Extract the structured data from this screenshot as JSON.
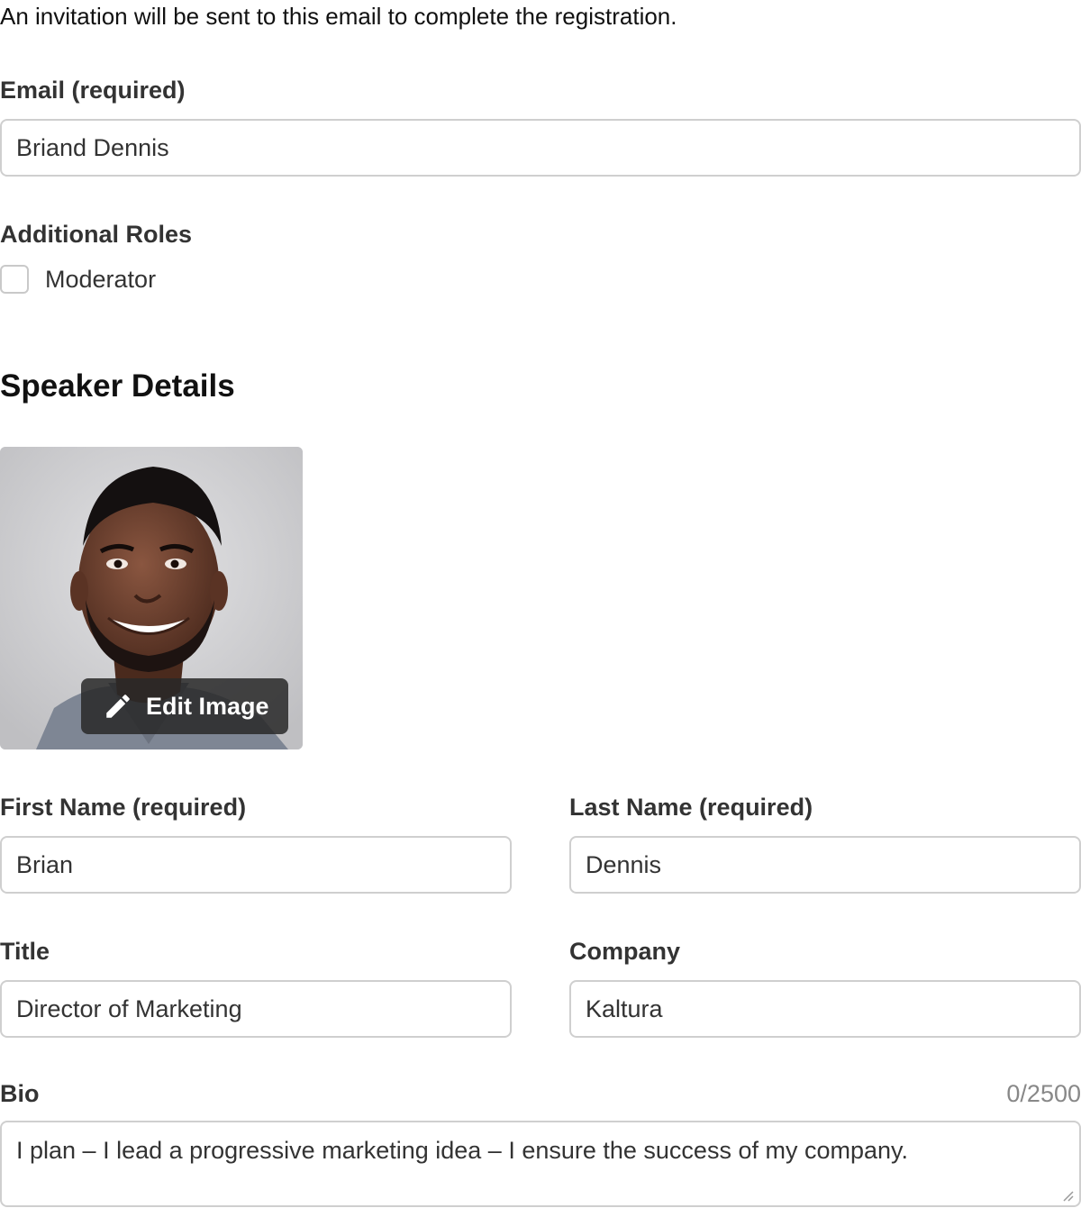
{
  "intro_text": "An invitation will be sent to this email to complete the registration.",
  "email": {
    "label": "Email (required)",
    "value": "Briand Dennis"
  },
  "additional_roles": {
    "label": "Additional Roles",
    "options": [
      {
        "label": "Moderator",
        "checked": false
      }
    ]
  },
  "speaker_details": {
    "title": "Speaker Details",
    "photo": {
      "icon": "profile-photo",
      "edit_label": "Edit Image",
      "edit_icon": "pencil-icon"
    },
    "first_name": {
      "label": "First Name (required)",
      "value": "Brian"
    },
    "last_name": {
      "label": "Last Name (required)",
      "value": "Dennis"
    },
    "title_field": {
      "label": "Title",
      "value": "Director of Marketing"
    },
    "company": {
      "label": "Company",
      "value": "Kaltura"
    },
    "bio": {
      "label": "Bio",
      "counter": "0/2500",
      "value": "I plan – I lead a progressive marketing idea – I ensure the success of my company."
    }
  }
}
